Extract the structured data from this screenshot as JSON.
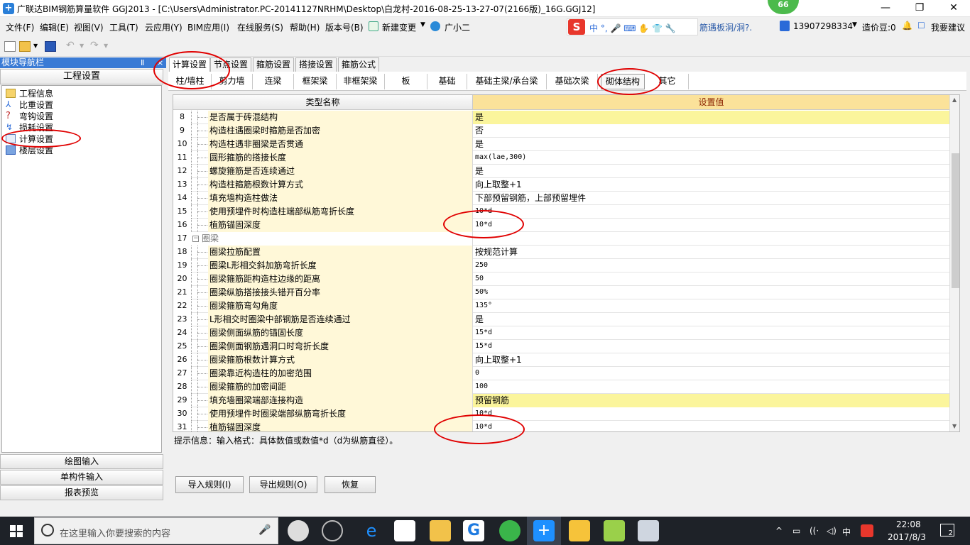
{
  "title": {
    "text": "广联达BIM钢筋算量软件 GGJ2013 - [C:\\Users\\Administrator.PC-20141127NRHM\\Desktop\\白龙村-2016-08-25-13-27-07(2166版)_16G.GGJ12]",
    "badge": "66",
    "minimize": "—",
    "restore": "❐",
    "close": "✕"
  },
  "menu": [
    "文件(F)",
    "编辑(E)",
    "视图(V)",
    "工具(T)",
    "云应用(Y)",
    "BIM应用(I)",
    "在线服务(S)",
    "帮助(H)",
    "版本号(B)",
    "新建变更",
    "广小二"
  ],
  "ime": {
    "s": "S",
    "text": "中 °, 🎤 ⌨ ✋ 👕 🔧",
    "link": "筋遇板洞/洞?."
  },
  "account": {
    "phone": "13907298334",
    "coins": "造价豆:0",
    "suggest": "我要建议"
  },
  "nav": {
    "header": "模块导航栏",
    "pin": "Ⅱ",
    "close": "×",
    "group": "工程设置",
    "items": [
      "工程信息",
      "比重设置",
      "弯钩设置",
      "损耗设置",
      "计算设置",
      "楼层设置"
    ],
    "bottom": [
      "绘图输入",
      "单构件输入",
      "报表预览"
    ]
  },
  "tabs1": [
    "计算设置",
    "节点设置",
    "箍筋设置",
    "搭接设置",
    "箍筋公式"
  ],
  "tabs2": [
    "柱/墙柱",
    "剪力墙",
    "连梁",
    "框架梁",
    "非框架梁",
    "板",
    "基础",
    "基础主梁/承台梁",
    "基础次梁",
    "砌体结构",
    "其它"
  ],
  "grid": {
    "header_name": "类型名称",
    "header_value": "设置值",
    "rows": [
      {
        "num": "8",
        "name": "是否属于砖混结构",
        "value": "是"
      },
      {
        "num": "9",
        "name": "构造柱遇圈梁时箍筋是否加密",
        "value": "否"
      },
      {
        "num": "10",
        "name": "构造柱遇非圈梁是否贯通",
        "value": "是"
      },
      {
        "num": "11",
        "name": "圆形箍筋的搭接长度",
        "value": "max(lae,300)"
      },
      {
        "num": "12",
        "name": "螺旋箍筋是否连续通过",
        "value": "是"
      },
      {
        "num": "13",
        "name": "构造柱箍筋根数计算方式",
        "value": "向上取整+1"
      },
      {
        "num": "14",
        "name": "填充墙构造柱做法",
        "value": "下部预留钢筋，上部预留埋件"
      },
      {
        "num": "15",
        "name": "使用预埋件时构造柱端部纵筋弯折长度",
        "value": "10*d"
      },
      {
        "num": "16",
        "name": "植筋锚固深度",
        "value": "10*d"
      },
      {
        "num": "17",
        "name": "圈梁",
        "value": ""
      },
      {
        "num": "18",
        "name": "圈梁拉筋配置",
        "value": "按规范计算"
      },
      {
        "num": "19",
        "name": "圈梁L形相交斜加筋弯折长度",
        "value": "250"
      },
      {
        "num": "20",
        "name": "圈梁箍筋距构造柱边缘的距离",
        "value": "50"
      },
      {
        "num": "21",
        "name": "圈梁纵筋搭接接头错开百分率",
        "value": "50%"
      },
      {
        "num": "22",
        "name": "圈梁箍筋弯勾角度",
        "value": "135°"
      },
      {
        "num": "23",
        "name": "L形相交时圈梁中部钢筋是否连续通过",
        "value": "是"
      },
      {
        "num": "24",
        "name": "圈梁侧面纵筋的锚固长度",
        "value": "15*d"
      },
      {
        "num": "25",
        "name": "圈梁侧面钢筋遇洞口时弯折长度",
        "value": "15*d"
      },
      {
        "num": "26",
        "name": "圈梁箍筋根数计算方式",
        "value": "向上取整+1"
      },
      {
        "num": "27",
        "name": "圈梁靠近构造柱的加密范围",
        "value": "0"
      },
      {
        "num": "28",
        "name": "圈梁箍筋的加密间距",
        "value": "100"
      },
      {
        "num": "29",
        "name": "填充墙圈梁端部连接构造",
        "value": "预留钢筋"
      },
      {
        "num": "30",
        "name": "使用预埋件时圈梁端部纵筋弯折长度",
        "value": "10*d"
      },
      {
        "num": "31",
        "name": "植筋锚固深度",
        "value": "10*d"
      }
    ]
  },
  "hint": "提示信息：输入格式：具体数值或数值*d（d为纵筋直径）。",
  "buttons": {
    "import": "导入规则(I)",
    "export": "导出规则(O)",
    "restore": "恢复"
  },
  "taskbar": {
    "search_placeholder": "在这里输入你要搜索的内容",
    "tray_lang": "中",
    "time": "22:08",
    "date": "2017/8/3",
    "notif": "2"
  },
  "colors": {
    "accent": "#3a7bd5",
    "header_value_bg": "#fbe29a",
    "highlight": "#fbf59c",
    "annotation": "#e00000"
  }
}
